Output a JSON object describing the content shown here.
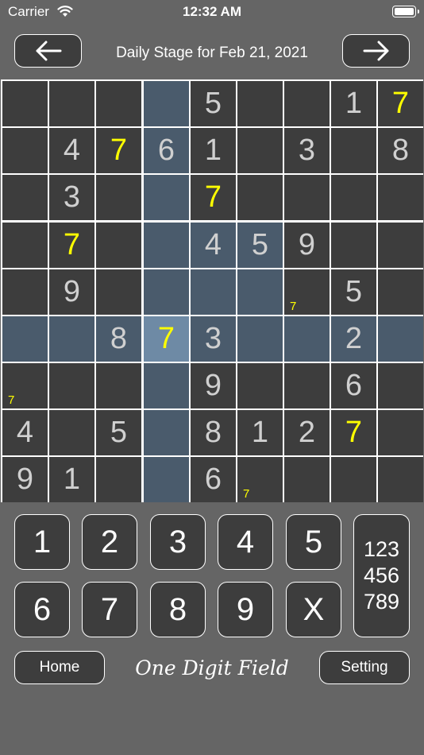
{
  "status_bar": {
    "carrier": "Carrier",
    "time": "12:32 AM"
  },
  "header": {
    "title": "Daily Stage for Feb 21, 2021"
  },
  "board": {
    "rows": [
      [
        "",
        "",
        "",
        "",
        "5",
        "",
        "",
        "1",
        "7"
      ],
      [
        "",
        "4",
        "7",
        "6",
        "1",
        "",
        "3",
        "",
        "8"
      ],
      [
        "",
        "3",
        "",
        "",
        "7",
        "",
        "",
        "",
        ""
      ],
      [
        "",
        "7",
        "",
        "",
        "4",
        "5",
        "9",
        "",
        ""
      ],
      [
        "",
        "9",
        "",
        "",
        "",
        "",
        "",
        "5",
        ""
      ],
      [
        "",
        "",
        "8",
        "7",
        "3",
        "",
        "",
        "2",
        ""
      ],
      [
        "",
        "",
        "",
        "",
        "9",
        "",
        "",
        "6",
        ""
      ],
      [
        "4",
        "",
        "5",
        "",
        "8",
        "1",
        "2",
        "7",
        ""
      ],
      [
        "9",
        "1",
        "",
        "",
        "6",
        "",
        "",
        "",
        ""
      ]
    ],
    "user_cells": [
      [
        0,
        8
      ],
      [
        1,
        2
      ],
      [
        2,
        4
      ],
      [
        3,
        1
      ],
      [
        5,
        3
      ],
      [
        7,
        7
      ]
    ],
    "memos": [
      {
        "row": 4,
        "col": 6,
        "text": "7"
      },
      {
        "row": 6,
        "col": 0,
        "text": "7"
      },
      {
        "row": 8,
        "col": 5,
        "text": "7"
      }
    ],
    "selected": {
      "row": 5,
      "col": 3
    },
    "highlighted_cells": [
      [
        3,
        4
      ],
      [
        3,
        5
      ],
      [
        4,
        3
      ],
      [
        4,
        4
      ],
      [
        4,
        5
      ],
      [
        5,
        6
      ]
    ],
    "colors": {
      "cell": "#3d3d3d",
      "highlight": "#4a5b6c",
      "selected": "#6e8aa5",
      "given": "#d0d0d0",
      "user": "#ffff00"
    }
  },
  "keypad": {
    "keys": [
      "1",
      "2",
      "3",
      "4",
      "5",
      "6",
      "7",
      "8",
      "9",
      "X"
    ],
    "memo_lines": [
      "123",
      "456",
      "789"
    ]
  },
  "footer": {
    "home": "Home",
    "brand": "One Digit Field",
    "setting": "Setting"
  }
}
